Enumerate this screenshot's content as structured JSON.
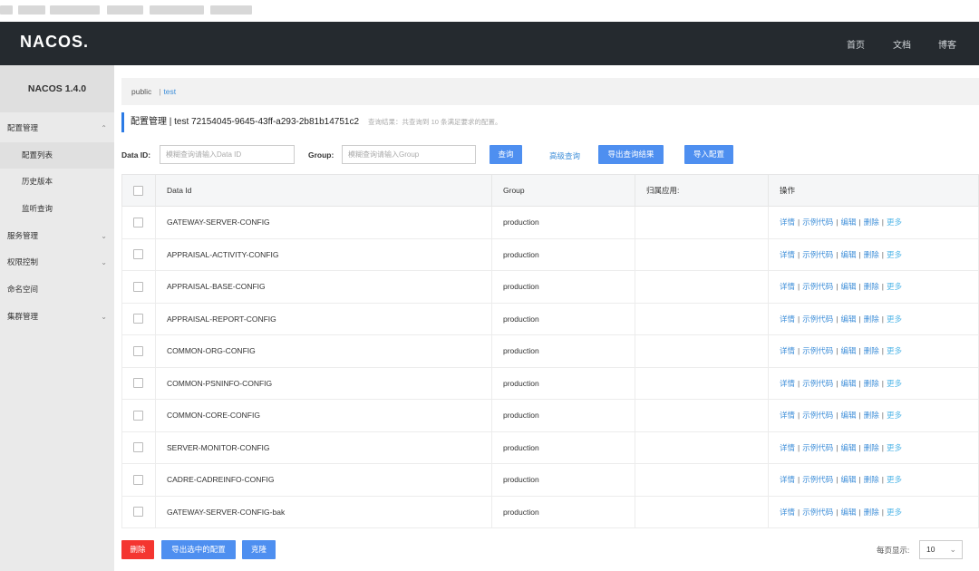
{
  "header": {
    "logo": "NACOS.",
    "nav": [
      "首页",
      "文档",
      "博客"
    ]
  },
  "sidebar": {
    "version": "NACOS 1.4.0",
    "items": [
      {
        "label": "配置管理",
        "chevron": "⌃"
      },
      {
        "label": "配置列表"
      },
      {
        "label": "历史版本"
      },
      {
        "label": "监听查询"
      },
      {
        "label": "服务管理",
        "chevron": "⌄"
      },
      {
        "label": "权限控制",
        "chevron": "⌄"
      },
      {
        "label": "命名空间"
      },
      {
        "label": "集群管理",
        "chevron": "⌄"
      }
    ]
  },
  "namespace": {
    "public": "public",
    "separator": "|",
    "test": "test"
  },
  "title": {
    "main": "配置管理 | test 72154045-9645-43ff-a293-2b81b14751c2",
    "hint": "查询结果：共查询到 10 条满足要求的配置。"
  },
  "search": {
    "dataid_label": "Data ID:",
    "dataid_placeholder": "模糊查询请输入Data ID",
    "group_label": "Group:",
    "group_placeholder": "模糊查询请输入Group",
    "query_button": "查询",
    "advanced_link": "高级查询",
    "export_button": "导出查询结果",
    "import_button": "导入配置"
  },
  "table": {
    "headers": [
      "Data Id",
      "Group",
      "归属应用:",
      "操作"
    ],
    "rows": [
      {
        "dataid": "GATEWAY-SERVER-CONFIG",
        "group": "production",
        "app": ""
      },
      {
        "dataid": "APPRAISAL-ACTIVITY-CONFIG",
        "group": "production",
        "app": ""
      },
      {
        "dataid": "APPRAISAL-BASE-CONFIG",
        "group": "production",
        "app": ""
      },
      {
        "dataid": "APPRAISAL-REPORT-CONFIG",
        "group": "production",
        "app": ""
      },
      {
        "dataid": "COMMON-ORG-CONFIG",
        "group": "production",
        "app": ""
      },
      {
        "dataid": "COMMON-PSNINFO-CONFIG",
        "group": "production",
        "app": ""
      },
      {
        "dataid": "COMMON-CORE-CONFIG",
        "group": "production",
        "app": ""
      },
      {
        "dataid": "SERVER-MONITOR-CONFIG",
        "group": "production",
        "app": ""
      },
      {
        "dataid": "CADRE-CADREINFO-CONFIG",
        "group": "production",
        "app": ""
      },
      {
        "dataid": "GATEWAY-SERVER-CONFIG-bak",
        "group": "production",
        "app": ""
      }
    ],
    "ops": [
      "详情",
      "示例代码",
      "编辑",
      "删除",
      "更多"
    ],
    "op_separator": "|"
  },
  "footer": {
    "delete_button": "删除",
    "export_selected_button": "导出选中的配置",
    "clone_button": "克隆",
    "page_size_label": "每页显示:",
    "page_size_value": "10",
    "page_size_chevron": "⌄"
  },
  "colors": {
    "header_bg": "#252a2f",
    "primary": "#4e8ff0",
    "danger": "#f43530",
    "link": "#3f8fd9"
  }
}
